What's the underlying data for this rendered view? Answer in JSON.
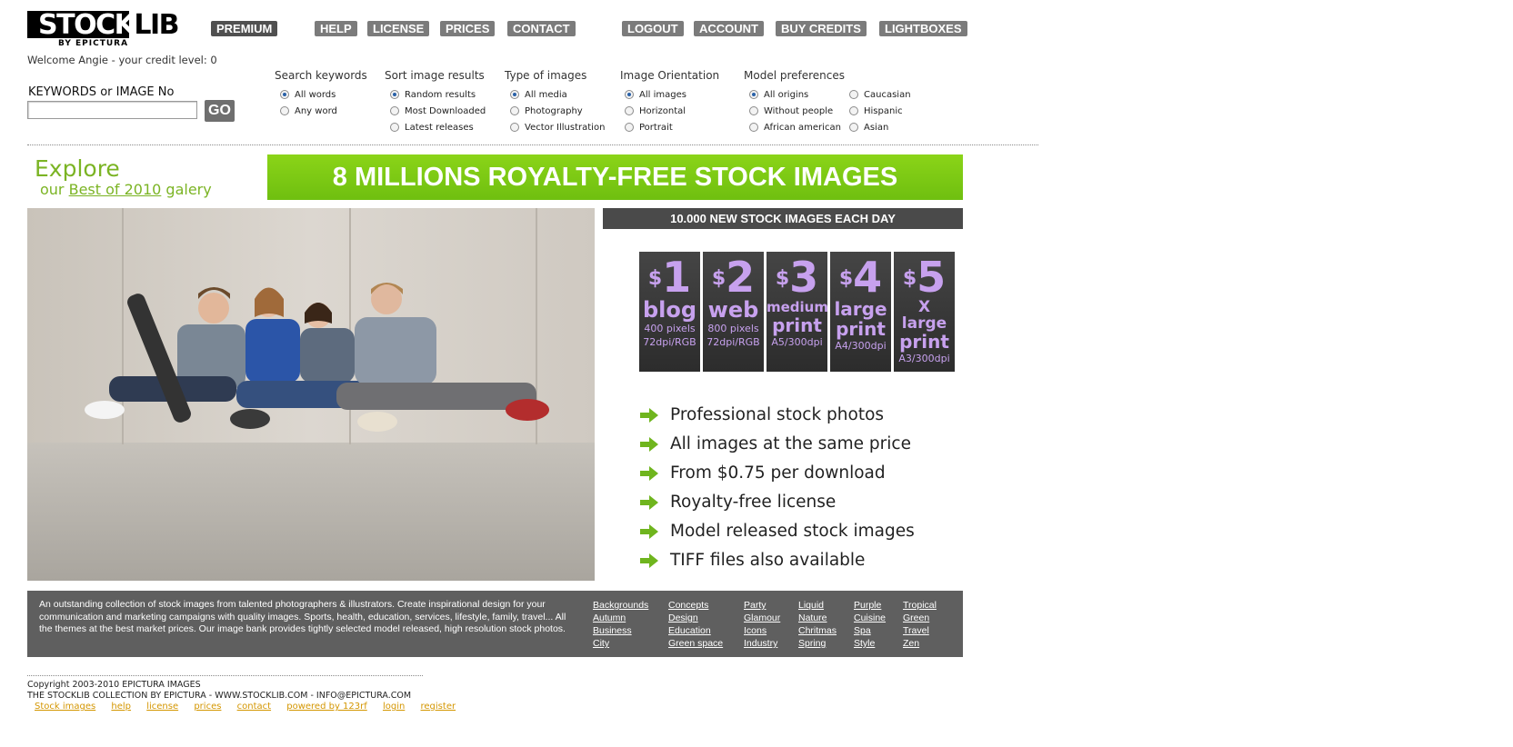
{
  "logo": {
    "word_a": "STOCK",
    "word_b": "LIB",
    "sub": "BY EPICTURA"
  },
  "nav": {
    "premium": "PREMIUM",
    "help": "HELP",
    "license": "LICENSE",
    "prices": "PRICES",
    "contact": "CONTACT",
    "logout": "LOGOUT",
    "account": "ACCOUNT",
    "buy_credits": "BUY CREDITS",
    "lightboxes": "LIGHTBOXES"
  },
  "welcome": "Welcome Angie - your credit level: 0",
  "search": {
    "label": "KEYWORDS or IMAGE No",
    "value": "",
    "go": "GO"
  },
  "filters": {
    "keywords": {
      "title": "Search keywords",
      "options": [
        "All words",
        "Any word"
      ],
      "selected": 0
    },
    "sort": {
      "title": "Sort image results",
      "options": [
        "Random results",
        "Most Downloaded",
        "Latest releases"
      ],
      "selected": 0
    },
    "type": {
      "title": "Type of images",
      "options": [
        "All media",
        " Photography",
        "Vector Illustration"
      ],
      "selected": 0
    },
    "orientation": {
      "title": "Image Orientation",
      "options": [
        "All images",
        "Horizontal",
        "Portrait"
      ],
      "selected": 0
    },
    "model": {
      "title": "Model preferences",
      "options": [
        "All origins",
        "Without people",
        "African american"
      ],
      "options2": [
        "Caucasian",
        "Hispanic",
        "Asian"
      ],
      "selected": 0
    }
  },
  "explore": {
    "line1": "Explore",
    "line2_a": "our ",
    "line2_link": "Best of 2010",
    "line2_b": " galery"
  },
  "banner": "8 MILLIONS ROYALTY-FREE STOCK IMAGES",
  "new_bar": "10.000 NEW STOCK IMAGES EACH DAY",
  "tiles": [
    {
      "cur": "$",
      "num": "1",
      "name": "blog",
      "l1": "400 pixels",
      "l2": "72dpi/RGB"
    },
    {
      "cur": "$",
      "num": "2",
      "name": "web",
      "l1": "800 pixels",
      "l2": "72dpi/RGB"
    },
    {
      "cur": "$",
      "num": "3",
      "name_a": "medium",
      "name_b": "print",
      "l2": "A5/300dpi"
    },
    {
      "cur": "$",
      "num": "4",
      "name_a": "large",
      "name_b": "print",
      "l2": "A4/300dpi"
    },
    {
      "cur": "$",
      "num": "5",
      "name_a": "X large",
      "name_b": "print",
      "l2": "A3/300dpi"
    }
  ],
  "features": [
    "Professional stock photos",
    "All images at the same price",
    "From $0.75 per download",
    "Royalty-free license",
    "Model released stock images",
    "TIFF files also available"
  ],
  "info_text": "An outstanding collection of stock images from talented photographers & illustrators. Create inspirational design for your communication and marketing campaigns with quality images. Sports, health, education, services, lifestyle, family, travel... All the themes at the best market prices. Our image bank provides tightly selected model released, high resolution stock photos.",
  "categories": [
    [
      "Backgrounds",
      "Autumn",
      "Business",
      "City"
    ],
    [
      "Concepts",
      "Design",
      "Education",
      "Green space"
    ],
    [
      "Party",
      "Glamour",
      "Icons",
      "Industry"
    ],
    [
      "Liquid",
      "Nature",
      "Chritmas",
      "Spring"
    ],
    [
      "Purple",
      "Cuisine",
      "Spa",
      "Style"
    ],
    [
      "Tropical",
      "Green",
      "Travel",
      "Zen"
    ]
  ],
  "copyright1": "Copyright 2003-2010 EPICTURA IMAGES",
  "copyright2": "THE STOCKLIB COLLECTION BY EPICTURA - WWW.STOCKLIB.COM - INFO@EPICTURA.COM",
  "footer_links": [
    "Stock images",
    "help",
    "license",
    "prices",
    "contact",
    "powered by 123rf",
    "login",
    "register"
  ],
  "colors": {
    "green": "#7bb424",
    "tile_text": "#c7a1ee",
    "nav_btn": "#7b7b7b",
    "footer_link": "#d49600"
  }
}
